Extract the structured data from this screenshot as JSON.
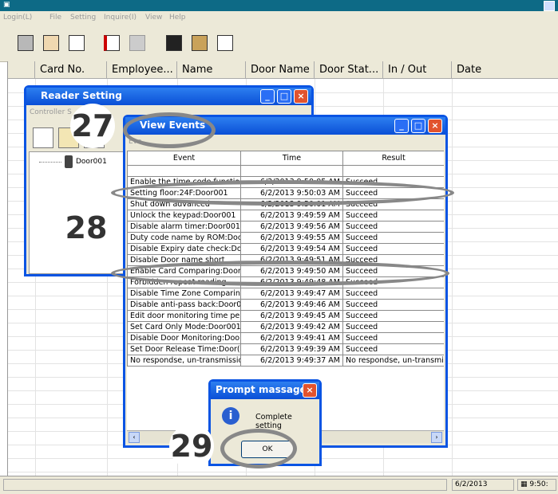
{
  "menu": {
    "items": [
      "Login(L)",
      "File",
      "Setting",
      "Inquire(I)",
      "View",
      "Help"
    ]
  },
  "toolbar_icons": [
    "calculator-icon",
    "user-card-icon",
    "document-icon",
    "door-in-icon",
    "door-out-icon",
    "monitor-icon",
    "clipboard-icon",
    "report-icon"
  ],
  "grid": {
    "columns": [
      "Card No.",
      "Employee...",
      "Name",
      "Door Name",
      "Door Stat...",
      "In / Out",
      "Date"
    ]
  },
  "reader_window": {
    "title": "Reader Setting",
    "subtitle": "Controller S",
    "tree_item": "Door001"
  },
  "events_window": {
    "title": "View Events",
    "subtitle": "Eve",
    "headers": [
      "Event",
      "Time",
      "Result"
    ],
    "rows": [
      {
        "event": "",
        "time": "",
        "result": ""
      },
      {
        "event": "Enable the time code function",
        "time": "6/2/2013 9:50:05 AM",
        "result": "Succeed"
      },
      {
        "event": "Setting floor:24F:Door001",
        "time": "6/2/2013 9:50:03 AM",
        "result": "Succeed"
      },
      {
        "event": "Shut down advanced",
        "time": "6/2/2013 9:50:01 AM",
        "result": "Succeed"
      },
      {
        "event": "Unlock the keypad:Door001",
        "time": "6/2/2013 9:49:59 AM",
        "result": "Succeed"
      },
      {
        "event": "Disable alarm timer:Door001",
        "time": "6/2/2013 9:49:56 AM",
        "result": "Succeed"
      },
      {
        "event": "Duty code name by ROM:Doc",
        "time": "6/2/2013 9:49:55 AM",
        "result": "Succeed"
      },
      {
        "event": "Disable Expiry date check:Do",
        "time": "6/2/2013 9:49:54 AM",
        "result": "Succeed"
      },
      {
        "event": "Disable Door name short",
        "time": "6/2/2013 9:49:51 AM",
        "result": "Succeed"
      },
      {
        "event": "Enable Card Comparing:Door(",
        "time": "6/2/2013 9:49:50 AM",
        "result": "Succeed"
      },
      {
        "event": "Forbidden repeat reading",
        "time": "6/2/2013 9:49:48 AM",
        "result": "Succeed"
      },
      {
        "event": "Disable Time Zone Comparing",
        "time": "6/2/2013 9:49:47 AM",
        "result": "Succeed"
      },
      {
        "event": "Disable anti-pass back:Door0",
        "time": "6/2/2013 9:49:46 AM",
        "result": "Succeed"
      },
      {
        "event": "Edit door monitoring time perio",
        "time": "6/2/2013 9:49:45 AM",
        "result": "Succeed"
      },
      {
        "event": "Set Card Only Mode:Door001",
        "time": "6/2/2013 9:49:42 AM",
        "result": "Succeed"
      },
      {
        "event": "Disable Door Monitoring:Door(",
        "time": "6/2/2013 9:49:41 AM",
        "result": "Succeed"
      },
      {
        "event": "Set Door Release Time:Door(",
        "time": "6/2/2013 9:49:39 AM",
        "result": "Succeed"
      },
      {
        "event": "No respondse, un-transmissior",
        "time": "6/2/2013 9:49:37 AM",
        "result": "No respondse, un-transmissio"
      }
    ]
  },
  "prompt": {
    "title": "Prompt massage",
    "message": "Complete setting",
    "ok_label": "OK"
  },
  "badges": {
    "b27": "27",
    "b28": "28",
    "b29": "29"
  },
  "status": {
    "date": "6/2/2013",
    "time": "9:50:"
  }
}
